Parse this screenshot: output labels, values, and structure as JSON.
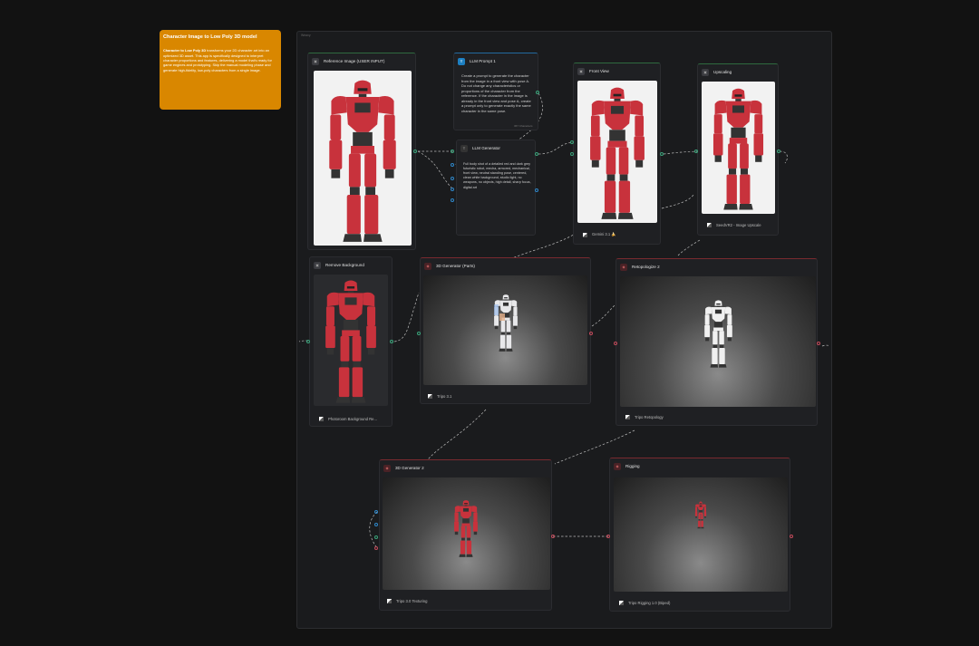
{
  "sticky": {
    "title": "Character Image to Low Poly 3D model",
    "bold_lead": "Character to Low Poly 3D",
    "body": " transforms your 2D character art into an optimized 3D asset. This app is specifically designed to interpret character proportions and features, delivering a model that's ready for game engines and prototyping. Skip the manual modeling phase and generate high-fidelity, low-poly characters from a single image."
  },
  "canvas": {
    "label": "Weavy"
  },
  "nodes": {
    "reference": {
      "title": "Reference Image (USER INPUT)"
    },
    "prompt": {
      "title": "LLM Prompt 1",
      "text": "Create a prompt to generate the character from the image in a front view with pose A. Do not change any characteristics or proportions of the character from the reference. If the character in the image is already in the front view and pose A, create a prompt only to generate exactly the same character in the same pose.",
      "chars": "367 Characters"
    },
    "generator": {
      "title": "LLM Generator",
      "text": "Full body shot of a detailed red and dark grey futuristic robot, mecha, armored, mechanical, front view, neutral standing pose, centered, clean white background, studio light, no weapons, no objects, high detail, sharp focus, digital art"
    },
    "front": {
      "title": "Front View",
      "footer": "Gemini 3.1 🍌"
    },
    "upscale": {
      "title": "Upscaling",
      "footer": "SeedVR2 - Image Upscale"
    },
    "remove_bg": {
      "title": "Remove Background",
      "footer": "Photoroom Background Re..."
    },
    "gen3d": {
      "title": "3D Generator (Parts)",
      "footer": "Tripo 3.1"
    },
    "retopo": {
      "title": "Retopologize 2",
      "footer": "Tripo Retopology"
    },
    "gen3d2": {
      "title": "3D Generator 2",
      "footer": "Tripo 3.0 Texturing"
    },
    "rigging": {
      "title": "Rigging",
      "footer": "Tripo Rigging 1.0 (Biped)"
    }
  },
  "colors": {
    "sticky": "#d98700",
    "accent_blue": "#1d7fc1",
    "port_green": "#3aa37a",
    "port_red": "#c24a5a",
    "robot_red": "#c8323c"
  },
  "icons": [
    "image-icon",
    "llm-icon",
    "text-icon",
    "model-icon",
    "rig-icon",
    "model-provider-icon"
  ]
}
